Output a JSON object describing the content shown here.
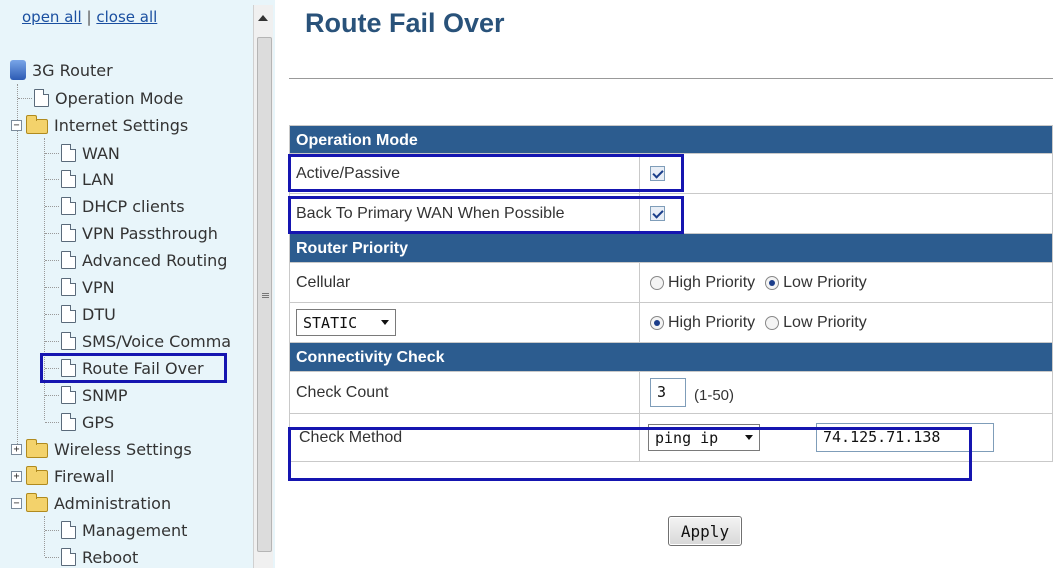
{
  "sidebar": {
    "open_all": "open all",
    "separator": "|",
    "close_all": "close all",
    "root": "3G Router",
    "items": {
      "operation_mode": "Operation Mode",
      "internet_settings": "Internet Settings",
      "wan": "WAN",
      "lan": "LAN",
      "dhcp_clients": "DHCP clients",
      "vpn_passthrough": "VPN Passthrough",
      "advanced_routing": "Advanced Routing",
      "vpn": "VPN",
      "dtu": "DTU",
      "sms_voice": "SMS/Voice Comma",
      "route_fail_over": "Route Fail Over",
      "snmp": "SNMP",
      "gps": "GPS",
      "wireless_settings": "Wireless Settings",
      "firewall": "Firewall",
      "administration": "Administration",
      "management": "Management",
      "reboot": "Reboot"
    }
  },
  "page": {
    "title": "Route Fail Over"
  },
  "operation_mode": {
    "header": "Operation Mode",
    "active_passive_label": "Active/Passive",
    "active_passive_checked": true,
    "back_to_primary_label": "Back To Primary WAN When Possible",
    "back_to_primary_checked": true
  },
  "router_priority": {
    "header": "Router Priority",
    "cellular_label": "Cellular",
    "cellular_priority": "Low Priority",
    "wan_select_value": "STATIC",
    "wan_priority": "High Priority",
    "high_label": "High Priority",
    "low_label": "Low Priority"
  },
  "connectivity_check": {
    "header": "Connectivity Check",
    "check_count_label": "Check Count",
    "check_count_value": "3",
    "check_count_hint": "(1-50)",
    "check_method_label": "Check Method",
    "check_method_value": "ping ip",
    "check_ip_value": "74.125.71.138"
  },
  "actions": {
    "apply_label": "Apply"
  },
  "colors": {
    "section_header": "#2c5c8f",
    "title": "#29527a",
    "highlight": "#1515b0",
    "sidebar_bg": "#e8f5fa"
  }
}
